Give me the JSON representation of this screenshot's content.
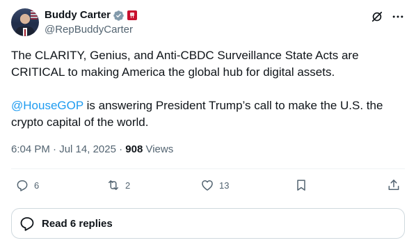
{
  "author": {
    "name": "Buddy Carter",
    "handle": "@RepBuddyCarter",
    "verified_color": "#829aab",
    "affiliation_color": "#c8102e"
  },
  "icons": {
    "top": [
      "grok-icon",
      "more-icon"
    ],
    "actions": [
      "reply-icon",
      "retweet-icon",
      "like-icon",
      "bookmark-icon",
      "share-icon"
    ],
    "replies": "speech-bubble-icon"
  },
  "post": {
    "line1": "The CLARITY, Genius, and Anti-CBDC Surveillance State Acts are CRITICAL to making America the global hub for digital assets.",
    "mention": "@HouseGOP",
    "line2": " is answering President Trump’s call to make the U.S. the crypto capital of the world."
  },
  "meta": {
    "time": "6:04 PM",
    "sep1": " · ",
    "date": "Jul 14, 2025",
    "sep2": " · ",
    "views_count": "908",
    "views_label": " Views"
  },
  "actions": {
    "replies": "6",
    "reposts": "2",
    "likes": "13"
  },
  "read_replies": "Read 6 replies",
  "colors": {
    "text": "#0f1419",
    "secondary": "#536471",
    "link": "#1d9bf0",
    "border": "#cfd9de"
  }
}
